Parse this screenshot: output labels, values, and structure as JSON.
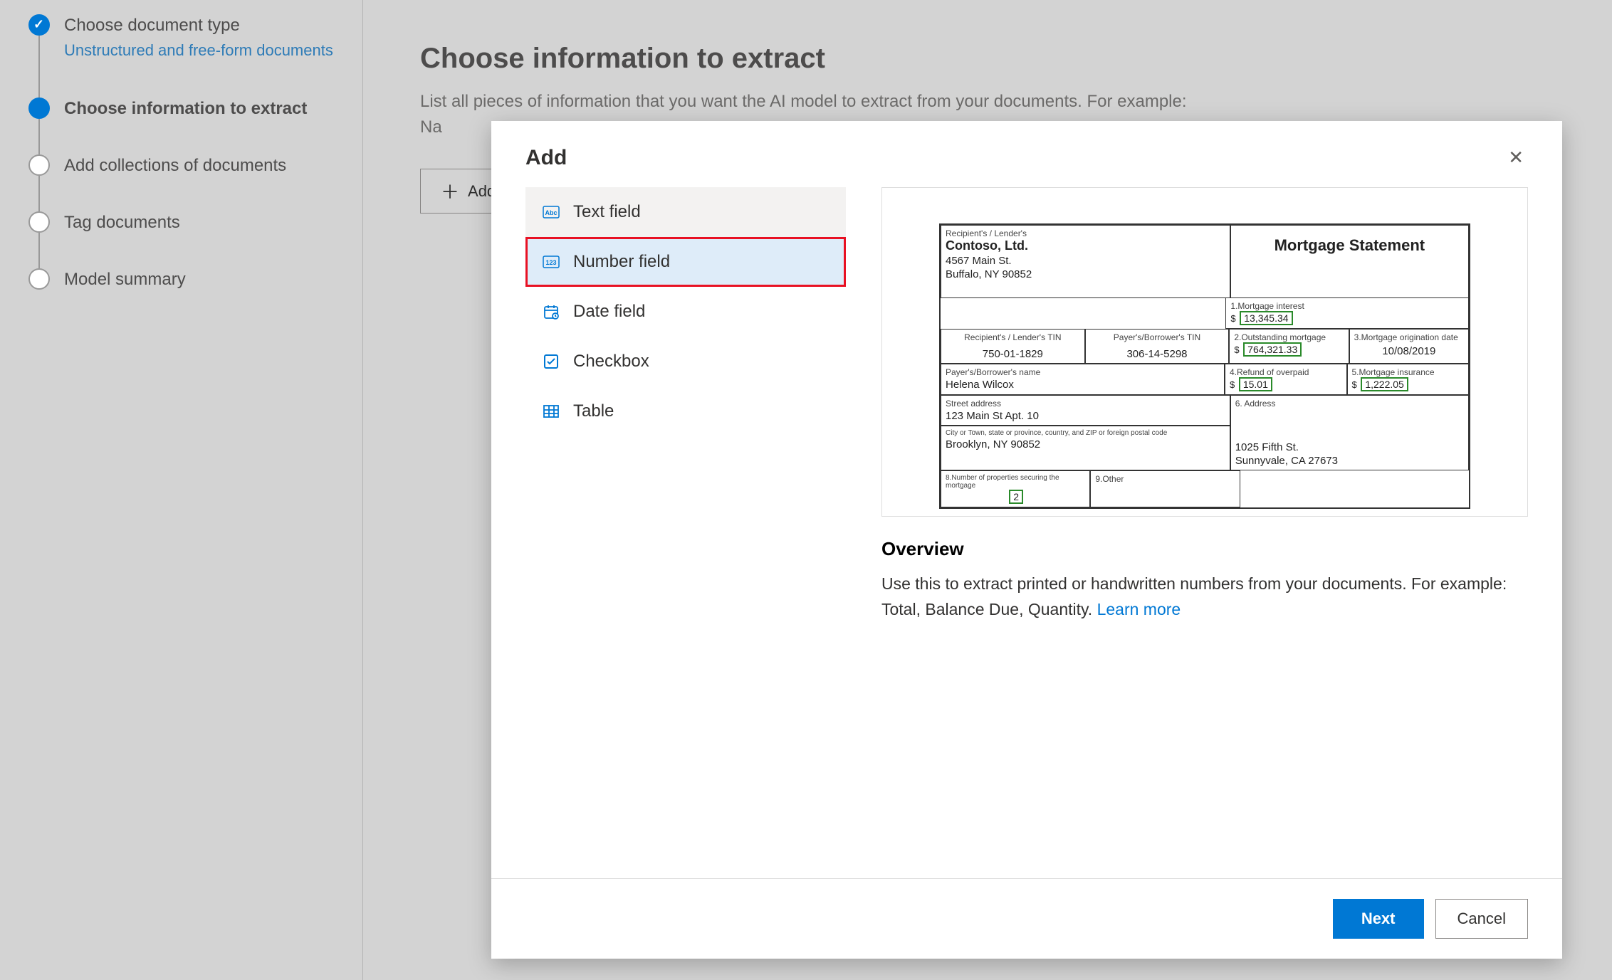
{
  "sidebar": {
    "steps": [
      {
        "title": "Choose document type",
        "sub": "Unstructured and free-form documents"
      },
      {
        "title": "Choose information to extract"
      },
      {
        "title": "Add collections of documents"
      },
      {
        "title": "Tag documents"
      },
      {
        "title": "Model summary"
      }
    ]
  },
  "main": {
    "heading": "Choose information to extract",
    "desc": "List all pieces of information that you want the AI model to extract from your documents. For example: Na",
    "add_btn": "Add"
  },
  "modal": {
    "title": "Add",
    "options": [
      {
        "label": "Text field",
        "icon": "Abc"
      },
      {
        "label": "Number field",
        "icon": "123"
      },
      {
        "label": "Date field",
        "icon": "cal"
      },
      {
        "label": "Checkbox",
        "icon": "check"
      },
      {
        "label": "Table",
        "icon": "table"
      }
    ],
    "preview": {
      "title": "Mortgage Statement",
      "lender_label": "Recipient's / Lender's",
      "lender_name": "Contoso, Ltd.",
      "lender_addr1": "4567 Main St.",
      "lender_addr2": "Buffalo, NY 90852",
      "f1_label": "1.Mortgage interest",
      "f1_val": "13,345.34",
      "rec_tin_label": "Recipient's / Lender's TIN",
      "rec_tin_val": "750-01-1829",
      "pay_tin_label": "Payer's/Borrower's TIN",
      "pay_tin_val": "306-14-5298",
      "f2_label": "2.Outstanding mortgage",
      "f2_val": "764,321.33",
      "f3_label": "3.Mortgage origination date",
      "f3_val": "10/08/2019",
      "f4_label": "4.Refund of overpaid",
      "f4_val": "15.01",
      "f5_label": "5.Mortgage insurance",
      "f5_val": "1,222.05",
      "borrower_label": "Payer's/Borrower's name",
      "borrower_val": "Helena Wilcox",
      "street_label": "Street address",
      "street_val": "123 Main St Apt. 10",
      "city_label": "City or Town, state or province, country, and ZIP or foreign postal code",
      "city_val": "Brooklyn, NY 90852",
      "f6_label": "6. Address",
      "f6_addr1": "1025 Fifth St.",
      "f6_addr2": "Sunnyvale, CA 27673",
      "f8_label": "8.Number of properties securing the mortgage",
      "f8_val": "2",
      "f9_label": "9.Other",
      "overview_h": "Overview",
      "overview_p": "Use this to extract printed or handwritten numbers from your documents. For example: Total, Balance Due, Quantity. ",
      "learn_more": "Learn more"
    },
    "next": "Next",
    "cancel": "Cancel"
  }
}
